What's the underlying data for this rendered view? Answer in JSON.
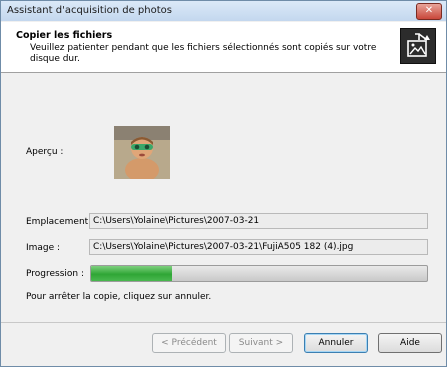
{
  "window": {
    "title": "Assistant d'acquisition de photos",
    "close_glyph": "✕"
  },
  "header": {
    "heading": "Copier les fichiers",
    "description": "Veuillez patienter pendant que les fichiers sélectionnés sont copiés sur votre disque dur.",
    "icon": "photo-import-icon"
  },
  "preview": {
    "label": "Aperçu :"
  },
  "fields": {
    "location_label": "Emplacement :",
    "location_value": "C:\\Users\\Yolaine\\Pictures\\2007-03-21",
    "image_label": "Image :",
    "image_value": "C:\\Users\\Yolaine\\Pictures\\2007-03-21\\FujiA505 182 (4).jpg"
  },
  "progress": {
    "label": "Progression :",
    "fraction": 0.24
  },
  "note": "Pour arrêter la copie, cliquez sur annuler.",
  "buttons": {
    "previous": "< Précédent",
    "next": "Suivant >",
    "cancel": "Annuler",
    "help": "Aide"
  },
  "colors": {
    "progress_fill": "#2fa636",
    "close_button": "#c9473a"
  }
}
